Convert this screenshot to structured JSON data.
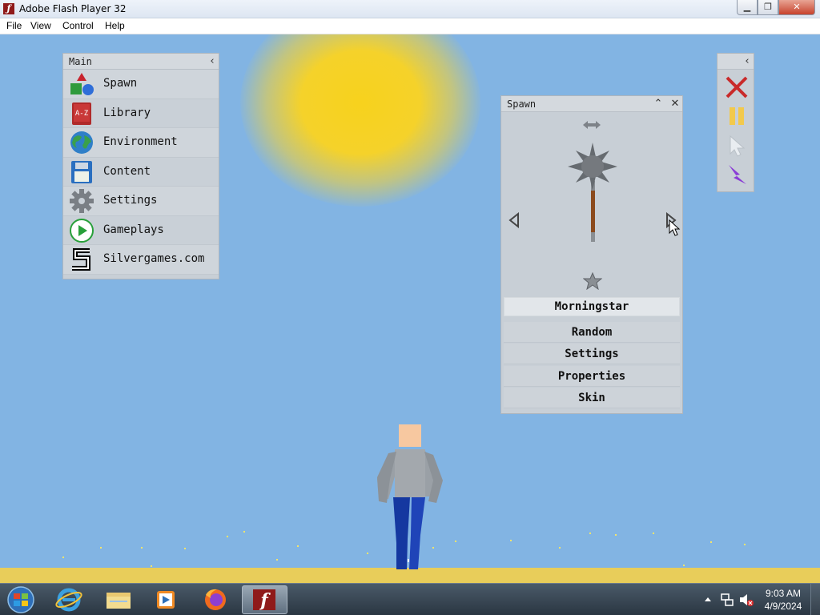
{
  "window": {
    "title": "Adobe Flash Player 32"
  },
  "menubar": {
    "items": [
      "File",
      "View",
      "Control",
      "Help"
    ]
  },
  "main_panel": {
    "title": "Main",
    "items": [
      {
        "label": "Spawn",
        "icon": "shapes-icon"
      },
      {
        "label": "Library",
        "icon": "book-az-icon"
      },
      {
        "label": "Environment",
        "icon": "globe-icon"
      },
      {
        "label": "Content",
        "icon": "floppy-disk-icon"
      },
      {
        "label": "Settings",
        "icon": "gear-icon"
      },
      {
        "label": "Gameplays",
        "icon": "play-icon"
      },
      {
        "label": "Silvergames.com",
        "icon": "silvergames-logo-icon"
      }
    ]
  },
  "spawn_panel": {
    "title": "Spawn",
    "selected_item": "Morningstar",
    "buttons": [
      "Random",
      "Settings",
      "Properties",
      "Skin"
    ]
  },
  "tools": [
    "close-x-icon",
    "pause-icon",
    "cursor-icon",
    "lightning-icon"
  ],
  "taskbar": {
    "apps": [
      "internet-explorer-icon",
      "file-explorer-icon",
      "media-player-icon",
      "firefox-icon",
      "flash-player-icon"
    ],
    "clock_time": "9:03 AM",
    "clock_date": "4/9/2024"
  },
  "colors": {
    "sky": "#82b4e3",
    "sun": "#f7d21d",
    "ground": "#e8cd5a",
    "panel": "#c8cfd6"
  }
}
